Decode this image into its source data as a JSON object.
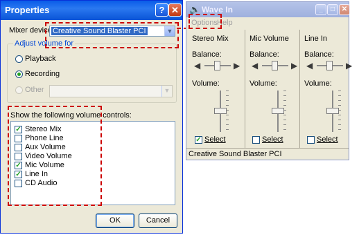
{
  "properties": {
    "title": "Properties",
    "help_button": "?",
    "close_button": "✕",
    "mixer_label": "Mixer device:",
    "mixer_value": "Creative Sound Blaster PCI",
    "adjust_label": "Adjust volume for",
    "radio_playback": "Playback",
    "radio_recording": "Recording",
    "radio_other": "Other",
    "selected_mode": "Recording",
    "controls_label": "Show the following volume controls:",
    "controls": [
      {
        "label": "Stereo Mix",
        "checked": true
      },
      {
        "label": "Phone Line",
        "checked": false
      },
      {
        "label": "Aux Volume",
        "checked": false
      },
      {
        "label": "Video Volume",
        "checked": false
      },
      {
        "label": "Mic Volume",
        "checked": true
      },
      {
        "label": "Line In",
        "checked": true
      },
      {
        "label": "CD Audio",
        "checked": false
      }
    ],
    "ok": "OK",
    "cancel": "Cancel"
  },
  "wave_in": {
    "title": "Wave In",
    "menu": [
      "Options",
      "Help"
    ],
    "columns": [
      {
        "name": "Stereo Mix",
        "balance_label": "Balance:",
        "volume_label": "Volume:",
        "select_label": "Select",
        "selected": true
      },
      {
        "name": "Mic Volume",
        "balance_label": "Balance:",
        "volume_label": "Volume:",
        "select_label": "Select",
        "selected": false
      },
      {
        "name": "Line In",
        "balance_label": "Balance:",
        "volume_label": "Volume:",
        "select_label": "Select",
        "selected": false
      }
    ],
    "status": "Creative Sound Blaster PCI"
  },
  "colors": {
    "annotation": "#cc0000",
    "xp_blue": "#0a5ce8",
    "check_green": "#21a121"
  }
}
